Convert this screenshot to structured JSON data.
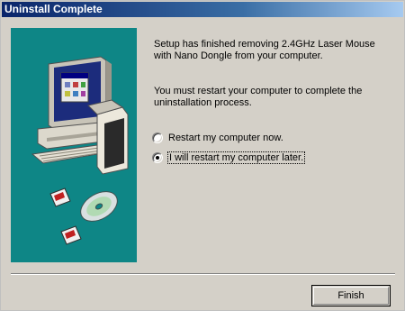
{
  "window": {
    "title": "Uninstall Complete"
  },
  "message": {
    "line1": "Setup has finished removing 2.4GHz Laser Mouse with Nano Dongle from your computer.",
    "line2": "You must restart your computer to complete the uninstallation process."
  },
  "options": [
    {
      "label": "Restart my computer now.",
      "selected": false
    },
    {
      "label": "I will restart my computer later.",
      "selected": true
    }
  ],
  "buttons": {
    "finish": "Finish"
  },
  "colors": {
    "panel": "#0e8686",
    "title_start": "#0a246a",
    "title_end": "#a6caf0",
    "dialog": "#d4d0c8"
  },
  "icons": [
    "computer-illustration",
    "floppy-disk-icon",
    "cd-disc-icon"
  ]
}
